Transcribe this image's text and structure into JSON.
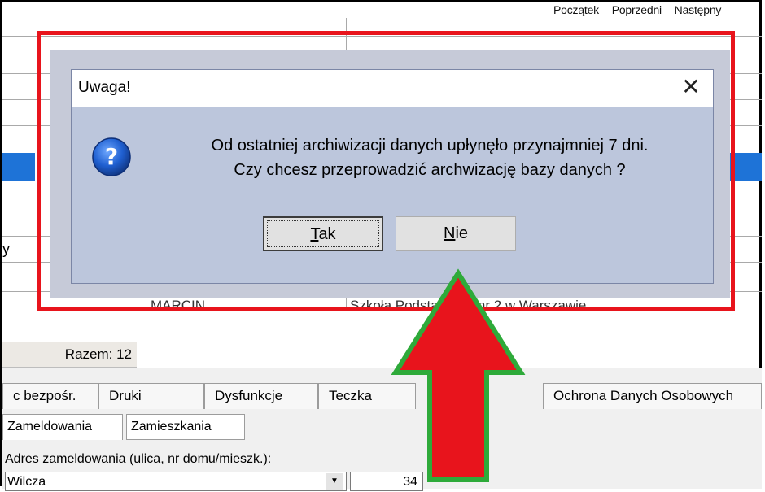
{
  "top_nav": {
    "items": [
      "Początek",
      "Poprzedni",
      "Następny"
    ]
  },
  "background": {
    "row_partial_text": "y",
    "partial_name": "MARCIN",
    "partial_school": "Szkoła Podstawowa nr 2 w Warszawie",
    "razem_label": "Razem: 12"
  },
  "tabs_main": [
    {
      "label": "c bezpośr."
    },
    {
      "label": "Druki"
    },
    {
      "label": "Dysfunkcje"
    },
    {
      "label": "Teczka"
    },
    {
      "label": "Ochrona Danych Osobowych"
    }
  ],
  "tabs_address": [
    {
      "label": "Zameldowania"
    },
    {
      "label": "Zamieszkania"
    }
  ],
  "address": {
    "label": "Adres zameldowania (ulica, nr domu/mieszk.):",
    "street_value": "Wilcza",
    "number_value": "34"
  },
  "dialog": {
    "title": "Uwaga!",
    "icon": "question-icon",
    "message_line1": "Od ostatniej archiwizacji danych upłynęło przynajmniej 7 dni.",
    "message_line2": "Czy chcesz przeprowadzić archwizację bazy danych ?",
    "btn_yes_accel": "T",
    "btn_yes_rest": "ak",
    "btn_no_accel": "N",
    "btn_no_rest": "ie"
  },
  "colors": {
    "highlight": "#e8141c",
    "arrow_fill": "#e8141c",
    "arrow_border": "#2eaa3a",
    "dialog_bg": "#bcc6dc",
    "selection_blue": "#1e73d7"
  }
}
